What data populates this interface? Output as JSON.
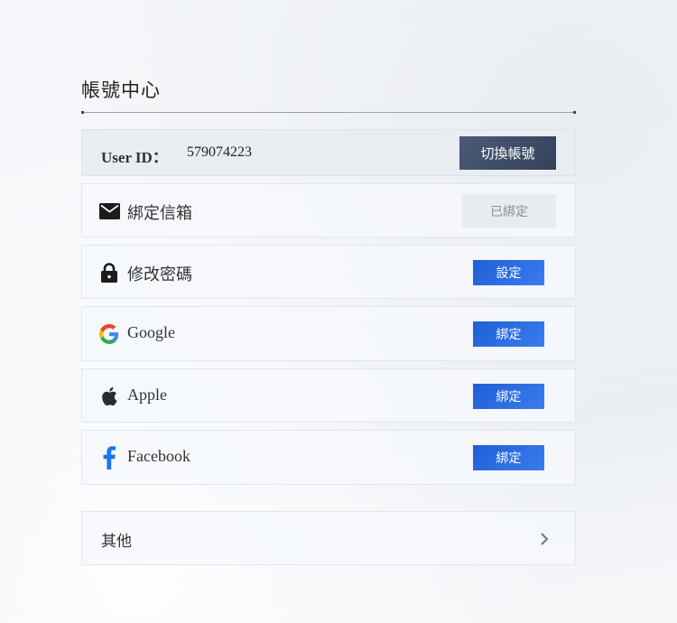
{
  "header": {
    "title": "帳號中心"
  },
  "user": {
    "id_label": "User ID：",
    "id_value": "579074223",
    "switch_label": "切換帳號"
  },
  "items": [
    {
      "icon": "mail-icon",
      "label": "綁定信箱",
      "action": "已綁定",
      "action_state": "bound"
    },
    {
      "icon": "lock-icon",
      "label": "修改密碼",
      "action": "設定",
      "action_state": "active"
    },
    {
      "icon": "google-icon",
      "label": "Google",
      "action": "綁定",
      "action_state": "active"
    },
    {
      "icon": "apple-icon",
      "label": "Apple",
      "action": "綁定",
      "action_state": "active"
    },
    {
      "icon": "facebook-icon",
      "label": "Facebook",
      "action": "綁定",
      "action_state": "active"
    }
  ],
  "other": {
    "label": "其他",
    "icon": "chevron-right-icon"
  },
  "colors": {
    "primary_button": "#2a6ce6",
    "switch_button": "#3d4b66",
    "facebook": "#1877f2",
    "bound_button_bg": "#e8ebef"
  }
}
